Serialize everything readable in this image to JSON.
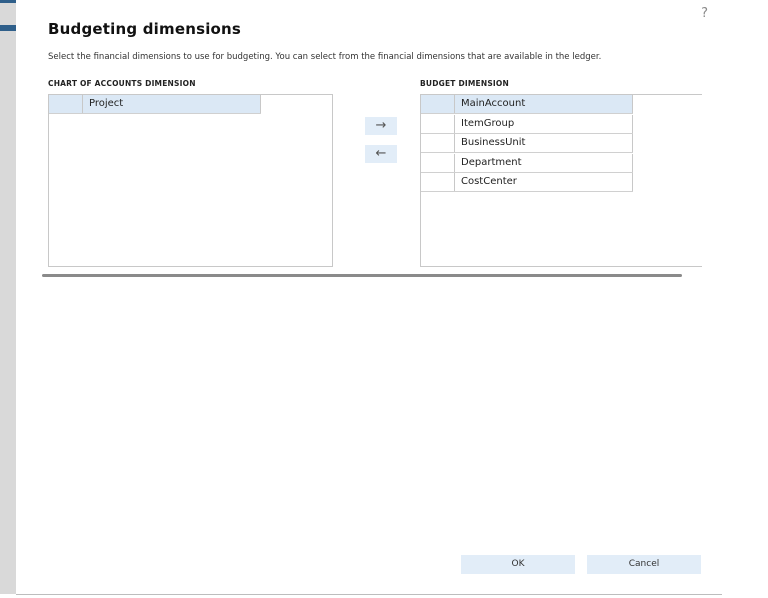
{
  "dialog": {
    "help_glyph": "?",
    "title": "Budgeting dimensions",
    "description": "Select the financial dimensions to use for budgeting. You can select from the financial dimensions that are available in the ledger."
  },
  "chart_of_accounts": {
    "label": "CHART OF ACCOUNTS DIMENSION",
    "items": [
      {
        "name": "Project",
        "selected": true
      }
    ]
  },
  "budget_dimension": {
    "label": "BUDGET DIMENSION",
    "items": [
      {
        "name": "MainAccount",
        "selected": true
      },
      {
        "name": "ItemGroup",
        "selected": false
      },
      {
        "name": "BusinessUnit",
        "selected": false
      },
      {
        "name": "Department",
        "selected": false
      },
      {
        "name": "CostCenter",
        "selected": false
      }
    ]
  },
  "move_buttons": {
    "add_glyph": "→",
    "remove_glyph": "←"
  },
  "footer": {
    "ok_label": "OK",
    "cancel_label": "Cancel"
  },
  "colors": {
    "selected_row": "#dbe8f5",
    "button_bg": "#e2edf8",
    "left_accent": "#2f5f8a"
  },
  "icons": {
    "help": "question-mark-icon",
    "add": "arrow-right-icon",
    "remove": "arrow-left-icon"
  }
}
